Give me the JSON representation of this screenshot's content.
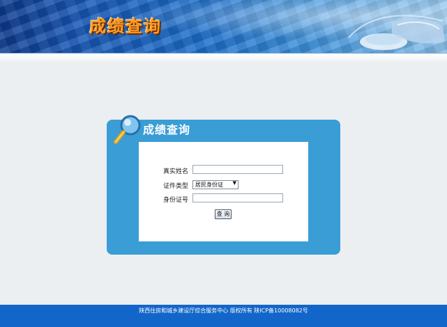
{
  "header": {
    "title": "成绩查询"
  },
  "panel": {
    "title": "成绩查询"
  },
  "form": {
    "name_label": "真实姓名",
    "name_value": "",
    "id_type_label": "证件类型",
    "id_type_selected": "居民身份证",
    "id_number_label": "身份证号",
    "id_number_value": "",
    "submit_label": "查 询"
  },
  "footer": {
    "text": "陕西住房和城乡建设厅综合服务中心 版权所有 陕ICP备10008082号"
  },
  "colors": {
    "banner_blue": "#1757b7",
    "title_orange": "#ff9b21",
    "panel_blue": "#3a9dd5",
    "footer_blue": "#1366c9",
    "page_bg": "#ebeff2"
  },
  "icons": [
    "magnifier-icon",
    "mouse-graphic"
  ]
}
